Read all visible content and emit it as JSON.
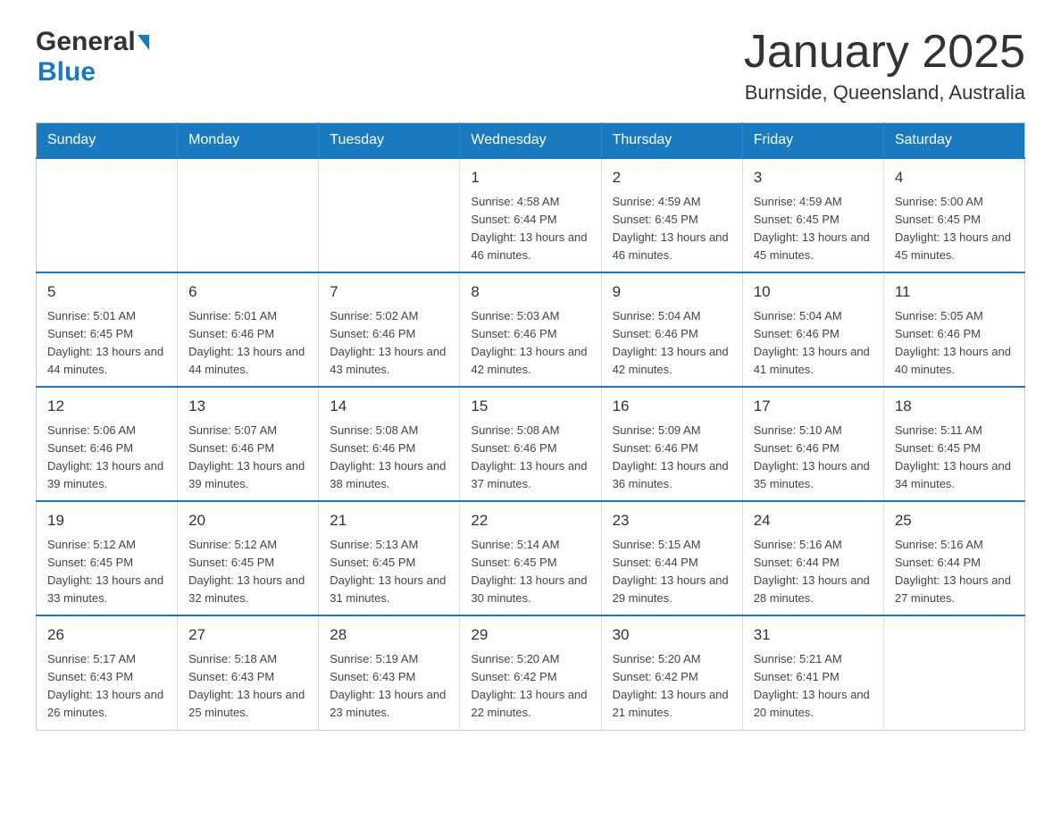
{
  "header": {
    "logo": {
      "general": "General",
      "blue": "Blue"
    },
    "title": "January 2025",
    "subtitle": "Burnside, Queensland, Australia"
  },
  "calendar": {
    "days_of_week": [
      "Sunday",
      "Monday",
      "Tuesday",
      "Wednesday",
      "Thursday",
      "Friday",
      "Saturday"
    ],
    "weeks": [
      [
        {
          "day": "",
          "info": ""
        },
        {
          "day": "",
          "info": ""
        },
        {
          "day": "",
          "info": ""
        },
        {
          "day": "1",
          "info": "Sunrise: 4:58 AM\nSunset: 6:44 PM\nDaylight: 13 hours and 46 minutes."
        },
        {
          "day": "2",
          "info": "Sunrise: 4:59 AM\nSunset: 6:45 PM\nDaylight: 13 hours and 46 minutes."
        },
        {
          "day": "3",
          "info": "Sunrise: 4:59 AM\nSunset: 6:45 PM\nDaylight: 13 hours and 45 minutes."
        },
        {
          "day": "4",
          "info": "Sunrise: 5:00 AM\nSunset: 6:45 PM\nDaylight: 13 hours and 45 minutes."
        }
      ],
      [
        {
          "day": "5",
          "info": "Sunrise: 5:01 AM\nSunset: 6:45 PM\nDaylight: 13 hours and 44 minutes."
        },
        {
          "day": "6",
          "info": "Sunrise: 5:01 AM\nSunset: 6:46 PM\nDaylight: 13 hours and 44 minutes."
        },
        {
          "day": "7",
          "info": "Sunrise: 5:02 AM\nSunset: 6:46 PM\nDaylight: 13 hours and 43 minutes."
        },
        {
          "day": "8",
          "info": "Sunrise: 5:03 AM\nSunset: 6:46 PM\nDaylight: 13 hours and 42 minutes."
        },
        {
          "day": "9",
          "info": "Sunrise: 5:04 AM\nSunset: 6:46 PM\nDaylight: 13 hours and 42 minutes."
        },
        {
          "day": "10",
          "info": "Sunrise: 5:04 AM\nSunset: 6:46 PM\nDaylight: 13 hours and 41 minutes."
        },
        {
          "day": "11",
          "info": "Sunrise: 5:05 AM\nSunset: 6:46 PM\nDaylight: 13 hours and 40 minutes."
        }
      ],
      [
        {
          "day": "12",
          "info": "Sunrise: 5:06 AM\nSunset: 6:46 PM\nDaylight: 13 hours and 39 minutes."
        },
        {
          "day": "13",
          "info": "Sunrise: 5:07 AM\nSunset: 6:46 PM\nDaylight: 13 hours and 39 minutes."
        },
        {
          "day": "14",
          "info": "Sunrise: 5:08 AM\nSunset: 6:46 PM\nDaylight: 13 hours and 38 minutes."
        },
        {
          "day": "15",
          "info": "Sunrise: 5:08 AM\nSunset: 6:46 PM\nDaylight: 13 hours and 37 minutes."
        },
        {
          "day": "16",
          "info": "Sunrise: 5:09 AM\nSunset: 6:46 PM\nDaylight: 13 hours and 36 minutes."
        },
        {
          "day": "17",
          "info": "Sunrise: 5:10 AM\nSunset: 6:46 PM\nDaylight: 13 hours and 35 minutes."
        },
        {
          "day": "18",
          "info": "Sunrise: 5:11 AM\nSunset: 6:45 PM\nDaylight: 13 hours and 34 minutes."
        }
      ],
      [
        {
          "day": "19",
          "info": "Sunrise: 5:12 AM\nSunset: 6:45 PM\nDaylight: 13 hours and 33 minutes."
        },
        {
          "day": "20",
          "info": "Sunrise: 5:12 AM\nSunset: 6:45 PM\nDaylight: 13 hours and 32 minutes."
        },
        {
          "day": "21",
          "info": "Sunrise: 5:13 AM\nSunset: 6:45 PM\nDaylight: 13 hours and 31 minutes."
        },
        {
          "day": "22",
          "info": "Sunrise: 5:14 AM\nSunset: 6:45 PM\nDaylight: 13 hours and 30 minutes."
        },
        {
          "day": "23",
          "info": "Sunrise: 5:15 AM\nSunset: 6:44 PM\nDaylight: 13 hours and 29 minutes."
        },
        {
          "day": "24",
          "info": "Sunrise: 5:16 AM\nSunset: 6:44 PM\nDaylight: 13 hours and 28 minutes."
        },
        {
          "day": "25",
          "info": "Sunrise: 5:16 AM\nSunset: 6:44 PM\nDaylight: 13 hours and 27 minutes."
        }
      ],
      [
        {
          "day": "26",
          "info": "Sunrise: 5:17 AM\nSunset: 6:43 PM\nDaylight: 13 hours and 26 minutes."
        },
        {
          "day": "27",
          "info": "Sunrise: 5:18 AM\nSunset: 6:43 PM\nDaylight: 13 hours and 25 minutes."
        },
        {
          "day": "28",
          "info": "Sunrise: 5:19 AM\nSunset: 6:43 PM\nDaylight: 13 hours and 23 minutes."
        },
        {
          "day": "29",
          "info": "Sunrise: 5:20 AM\nSunset: 6:42 PM\nDaylight: 13 hours and 22 minutes."
        },
        {
          "day": "30",
          "info": "Sunrise: 5:20 AM\nSunset: 6:42 PM\nDaylight: 13 hours and 21 minutes."
        },
        {
          "day": "31",
          "info": "Sunrise: 5:21 AM\nSunset: 6:41 PM\nDaylight: 13 hours and 20 minutes."
        },
        {
          "day": "",
          "info": ""
        }
      ]
    ]
  }
}
